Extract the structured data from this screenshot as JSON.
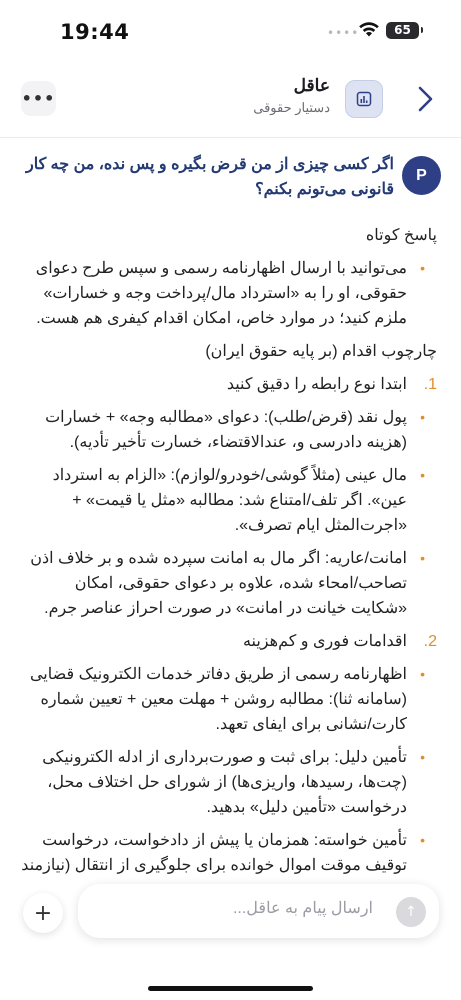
{
  "status_bar": {
    "time": "19:44",
    "battery": "65"
  },
  "header": {
    "title": "عاقل",
    "subtitle": "دستیار حقوقی",
    "menu_icon": "ellipsis-icon",
    "avatar_icon": "chart-icon",
    "back_icon": "chevron-right-icon"
  },
  "conversation": {
    "user_avatar": "P",
    "user_message": "اگر کسی چیزی از من قرض بگیره و پس نده، من چه کار قانونی می‌تونم بکنم؟",
    "answer": {
      "short_heading": "پاسخ کوتاه",
      "short_bullets": [
        "می‌توانید با ارسال اظهارنامه رسمی و سپس طرح دعوای حقوقی، او را به «استرداد مال/پرداخت وجه و خسارات» ملزم کنید؛ در موارد خاص، امکان اقدام کیفری هم هست."
      ],
      "framework_heading": "چارچوب اقدام (بر پایه حقوق ایران)",
      "steps": [
        {
          "number": "1.",
          "title": "ابتدا نوع رابطه را دقیق کنید",
          "bullets": [
            "پول نقد (قرض/طلب): دعوای «مطالبه وجه» + خسارات (هزینه دادرسی و، عندالاقتضاء، خسارت تأخیر تأدیه).",
            "مال عینی (مثلاً گوشی/خودرو/لوازم): «الزام به استرداد عین». اگر تلف/امتناع شد: مطالبه «مثل یا قیمت» + «اجرت‌المثل ایام تصرف».",
            "امانت/عاریه: اگر مال به امانت سپرده شده و بر خلاف اذن تصاحب/امحاء شده، علاوه بر دعوای حقوقی، امکان «شکایت خیانت در امانت» در صورت احراز عناصر جرم."
          ]
        },
        {
          "number": "2.",
          "title": "اقدامات فوری و کم‌هزینه",
          "bullets": [
            "اظهارنامه رسمی از طریق دفاتر خدمات الکترونیک قضایی (سامانه ثنا): مطالبه روشن + مهلت معین + تعیین شماره کارت/نشانی برای ایفای تعهد.",
            "تأمین دلیل: برای ثبت و صورت‌برداری از ادله الکترونیکی (چت‌ها، رسیدها، واریزی‌ها) از شورای حل اختلاف محل، درخواست «تأمین دلیل» بدهید.",
            "تأمین خواسته: همزمان یا پیش از دادخواست، درخواست توقیف موقت اموال خوانده برای جلوگیری از انتقال (نیازمند"
          ]
        }
      ]
    }
  },
  "composer": {
    "placeholder": "ارسال پیام به عاقل...",
    "plus_icon": "plus-icon",
    "send_icon": "arrow-up-icon"
  }
}
